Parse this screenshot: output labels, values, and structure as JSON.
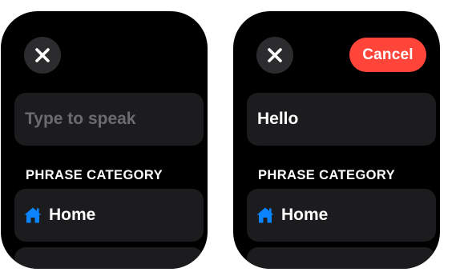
{
  "screens": [
    {
      "close_icon": "xmark-icon",
      "text_field": {
        "placeholder": "Type to speak",
        "value": ""
      },
      "section_label": "PHRASE CATEGORY",
      "category": {
        "icon": "house-icon",
        "label": "Home"
      }
    },
    {
      "close_icon": "xmark-icon",
      "cancel_label": "Cancel",
      "text_field": {
        "placeholder": "",
        "value": "Hello"
      },
      "section_label": "PHRASE CATEGORY",
      "category": {
        "icon": "house-icon",
        "label": "Home"
      }
    }
  ],
  "colors": {
    "background": "#000000",
    "surface": "#1c1c1e",
    "button_gray": "#2c2c2e",
    "accent_red": "#ff453a",
    "icon_blue": "#0a84ff",
    "placeholder_gray": "#6b6b70"
  }
}
